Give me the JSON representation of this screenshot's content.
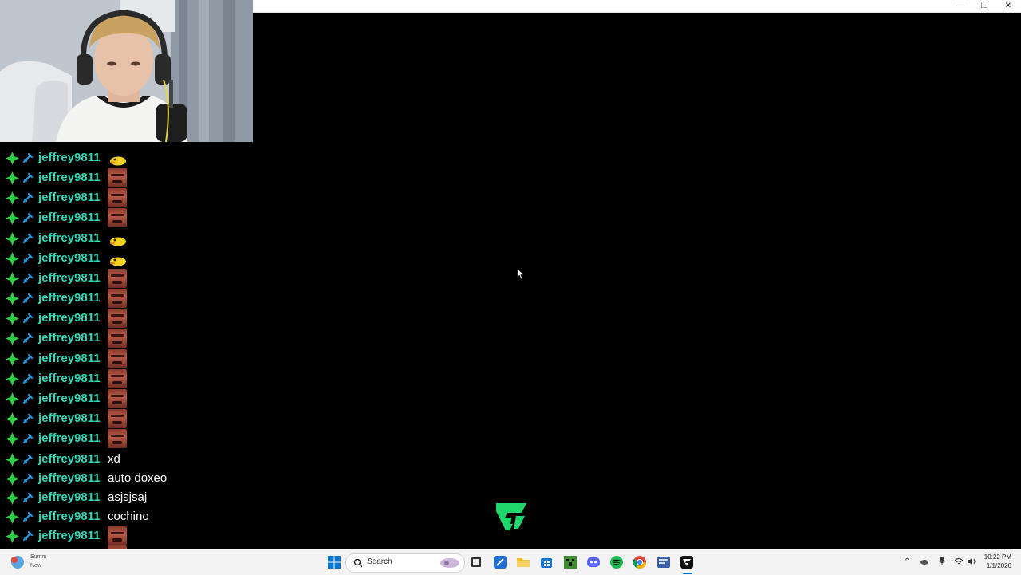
{
  "window": {
    "minimize_icon": "—",
    "restore_icon": "❐",
    "close_icon": "✕"
  },
  "chat": {
    "messages": [
      {
        "user": "jeffrey9811",
        "type": "emote",
        "emote": "duck"
      },
      {
        "user": "jeffrey9811",
        "type": "emote",
        "emote": "face"
      },
      {
        "user": "jeffrey9811",
        "type": "emote",
        "emote": "face"
      },
      {
        "user": "jeffrey9811",
        "type": "emote",
        "emote": "face"
      },
      {
        "user": "jeffrey9811",
        "type": "emote",
        "emote": "duck"
      },
      {
        "user": "jeffrey9811",
        "type": "emote",
        "emote": "duck"
      },
      {
        "user": "jeffrey9811",
        "type": "emote",
        "emote": "face"
      },
      {
        "user": "jeffrey9811",
        "type": "emote",
        "emote": "face"
      },
      {
        "user": "jeffrey9811",
        "type": "emote",
        "emote": "face"
      },
      {
        "user": "jeffrey9811",
        "type": "emote",
        "emote": "face"
      },
      {
        "user": "jeffrey9811",
        "type": "emote",
        "emote": "face"
      },
      {
        "user": "jeffrey9811",
        "type": "emote",
        "emote": "face"
      },
      {
        "user": "jeffrey9811",
        "type": "emote",
        "emote": "face"
      },
      {
        "user": "jeffrey9811",
        "type": "emote",
        "emote": "face"
      },
      {
        "user": "jeffrey9811",
        "type": "emote",
        "emote": "face"
      },
      {
        "user": "jeffrey9811",
        "type": "text",
        "text": "xd"
      },
      {
        "user": "jeffrey9811",
        "type": "text",
        "text": "auto doxeo"
      },
      {
        "user": "jeffrey9811",
        "type": "text",
        "text": "asjsjsaj"
      },
      {
        "user": "jeffrey9811",
        "type": "text",
        "text": "cochino"
      },
      {
        "user": "jeffrey9811",
        "type": "emote",
        "emote": "face"
      },
      {
        "user": "jeffrey9811",
        "type": "emote",
        "emote": "face"
      }
    ],
    "username_color": "#31d6b7"
  },
  "taskbar": {
    "search_placeholder": "Search",
    "notification": {
      "title": "Summ",
      "time": "Now"
    },
    "clock": {
      "time": "10:22 PM",
      "date": "1/1/2026"
    },
    "tray_chevron": "^",
    "apps": [
      "start-icon",
      "widgets-icon",
      "file-manager-icon",
      "store-icon",
      "folder-icon",
      "calendar-icon",
      "minecraft-icon",
      "discord-icon",
      "spotify-icon",
      "chrome-icon",
      "app-icon",
      "ea-fc-icon"
    ]
  },
  "colors": {
    "sub_badge": "#2fcf45",
    "mod_badge": "#1e9be0",
    "accent": "#0067c0"
  }
}
